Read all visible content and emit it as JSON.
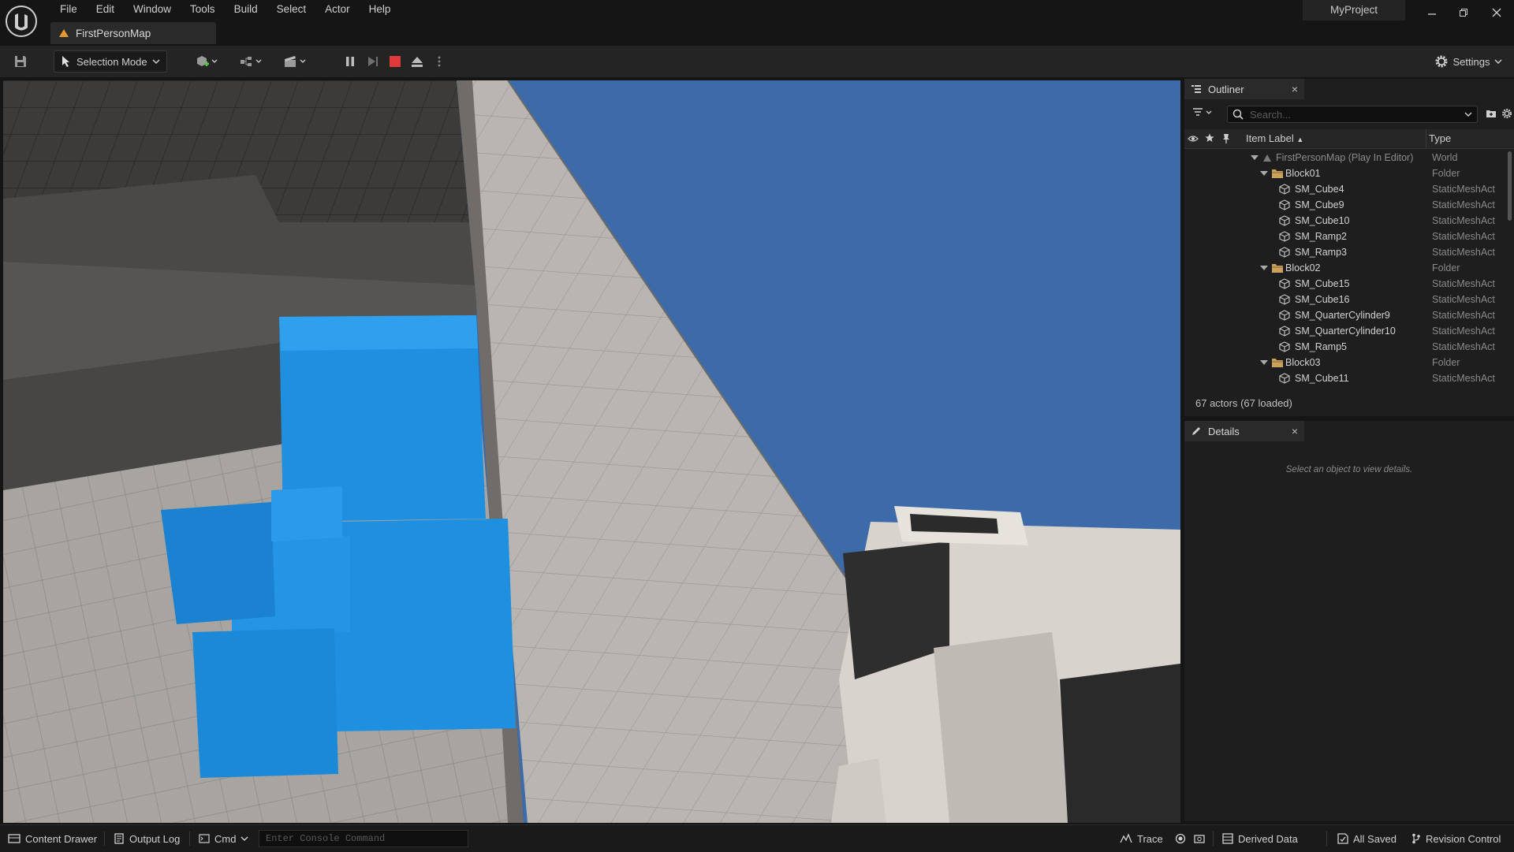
{
  "menu": [
    "File",
    "Edit",
    "Window",
    "Tools",
    "Build",
    "Select",
    "Actor",
    "Help"
  ],
  "project_name": "MyProject",
  "document_tab": "FirstPersonMap",
  "toolbar": {
    "selection_mode": "Selection Mode",
    "settings": "Settings"
  },
  "outliner": {
    "tab": "Outliner",
    "search_placeholder": "Search...",
    "col_label": "Item Label",
    "col_type": "Type",
    "rows": [
      {
        "label": "FirstPersonMap (Play In Editor)",
        "type": "World"
      },
      {
        "label": "Block01",
        "type": "Folder"
      },
      {
        "label": "SM_Cube4",
        "type": "StaticMeshAct"
      },
      {
        "label": "SM_Cube9",
        "type": "StaticMeshAct"
      },
      {
        "label": "SM_Cube10",
        "type": "StaticMeshAct"
      },
      {
        "label": "SM_Ramp2",
        "type": "StaticMeshAct"
      },
      {
        "label": "SM_Ramp3",
        "type": "StaticMeshAct"
      },
      {
        "label": "Block02",
        "type": "Folder"
      },
      {
        "label": "SM_Cube15",
        "type": "StaticMeshAct"
      },
      {
        "label": "SM_Cube16",
        "type": "StaticMeshAct"
      },
      {
        "label": "SM_QuarterCylinder9",
        "type": "StaticMeshAct"
      },
      {
        "label": "SM_QuarterCylinder10",
        "type": "StaticMeshAct"
      },
      {
        "label": "SM_Ramp5",
        "type": "StaticMeshAct"
      },
      {
        "label": "Block03",
        "type": "Folder"
      },
      {
        "label": "SM_Cube11",
        "type": "StaticMeshAct"
      }
    ],
    "actor_count": "67 actors (67 loaded)"
  },
  "details": {
    "tab": "Details",
    "empty": "Select an object to view details."
  },
  "status": {
    "content_drawer": "Content Drawer",
    "output_log": "Output Log",
    "cmd": "Cmd",
    "console_placeholder": "Enter Console Command",
    "trace": "Trace",
    "derived_data": "Derived Data",
    "all_saved": "All Saved",
    "revision_control": "Revision Control"
  },
  "colors": {
    "sky": "#3d6aa8",
    "cube_blue": "#1f8fe0",
    "floor_light": "#b9b6b2",
    "folder": "#c9a15a",
    "stop_red": "#e03a3a"
  }
}
